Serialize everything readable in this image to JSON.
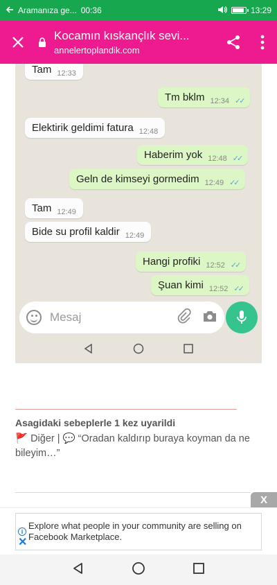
{
  "status_bar": {
    "notification_text": "Aramanıza ge...",
    "notification_time": "00:36",
    "clock": "13:29"
  },
  "browser": {
    "page_title": "Kocamın kıskançlık sevi...",
    "url": "annelertoplandik.com",
    "accent_color": "#ee1a8f"
  },
  "chat": {
    "messages": [
      {
        "text": "Tam",
        "time": "12:33",
        "direction": "in"
      },
      {
        "text": "Tm bklm",
        "time": "12:34",
        "direction": "out"
      },
      {
        "text": "Elektirik geldimi fatura",
        "time": "12:48",
        "direction": "in"
      },
      {
        "text": "Haberim yok",
        "time": "12:48",
        "direction": "out"
      },
      {
        "text": "Geln de kimseyi gormedim",
        "time": "12:49",
        "direction": "out"
      },
      {
        "text": "Tam",
        "time": "12:49",
        "direction": "in"
      },
      {
        "text": "Bide su profil kaldir",
        "time": "12:49",
        "direction": "in"
      },
      {
        "text": "Hangi profiki",
        "time": "12:52",
        "direction": "out"
      },
      {
        "text": "Şuan kimi",
        "time": "12:52",
        "direction": "out"
      }
    ],
    "composer_placeholder": "Mesaj"
  },
  "warning": {
    "title": "Asagidaki sebeplerle 1 kez uyarildi",
    "body": "🚩 Diğer | 💬 “Oradan kaldırıp buraya koyman da ne bileyim…”"
  },
  "ad": {
    "close_label": "X",
    "text": "Explore what people in your community are selling on Facebook Marketplace."
  }
}
